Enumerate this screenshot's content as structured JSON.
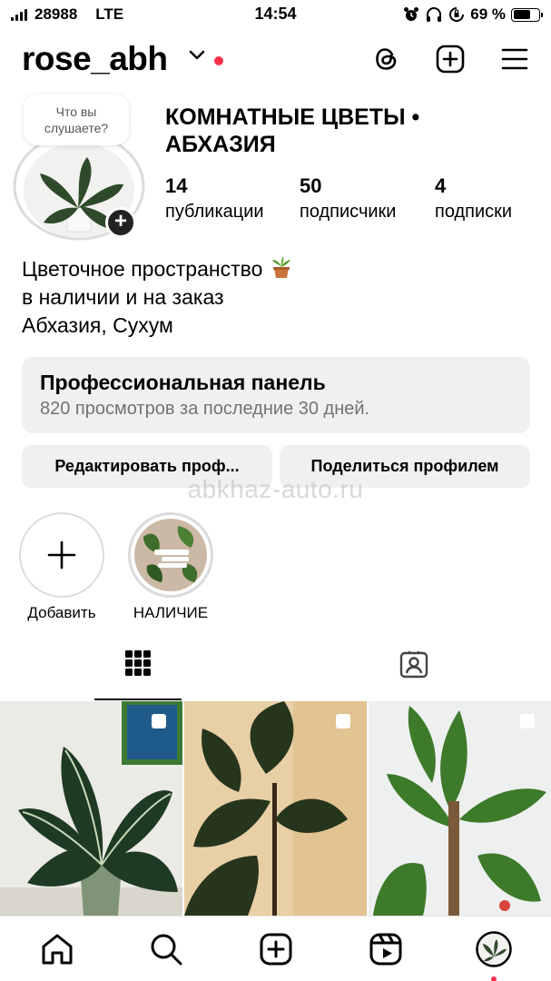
{
  "status_bar": {
    "carrier": "28988",
    "network": "LTE",
    "time": "14:54",
    "battery": "69 %",
    "battery_level": 0.69
  },
  "header": {
    "username": "rose_abh"
  },
  "profile": {
    "note_text": "Что вы слушаете?",
    "full_name": "КОМНАТНЫЕ ЦВЕТЫ • АБХАЗИЯ",
    "stats": [
      {
        "count": "14",
        "label": "публикации"
      },
      {
        "count": "50",
        "label": "подписчики"
      },
      {
        "count": "4",
        "label": "подписки"
      }
    ],
    "bio": {
      "line1": "Цветочное пространство",
      "line2": "в наличии и на заказ",
      "line3": "Абхазия, Сухум"
    }
  },
  "pro_panel": {
    "title": "Профессиональная панель",
    "subtitle": "820 просмотров за последние 30 дней."
  },
  "buttons": {
    "edit": "Редактировать проф...",
    "share": "Поделиться профилем"
  },
  "watermark": "abkhaz-auto.ru",
  "highlights": [
    {
      "label": "Добавить"
    },
    {
      "label": "НАЛИЧИЕ"
    }
  ],
  "colors": {
    "accent_red": "#ff2f4a",
    "panel_bg": "#eff0f2",
    "muted_text": "#737373"
  },
  "icons": {
    "header": [
      "threads-icon",
      "new-post-icon",
      "menu-icon"
    ],
    "tabs": [
      "grid-icon",
      "tagged-icon"
    ],
    "nav": [
      "home-icon",
      "search-icon",
      "create-icon",
      "reels-icon",
      "profile-avatar"
    ]
  }
}
